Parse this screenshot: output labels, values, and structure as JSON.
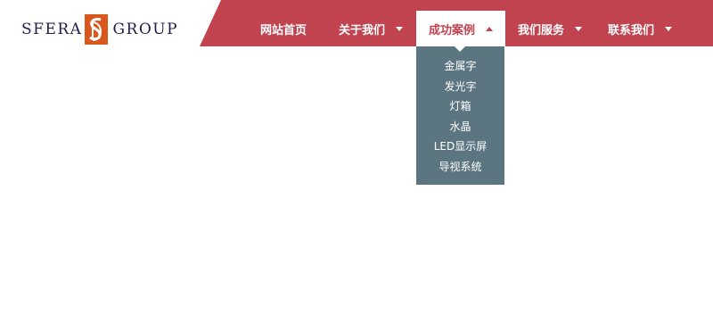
{
  "logo": {
    "left_text": "SFERA",
    "right_text": "GROUP",
    "mark_icon": "sd-monogram-icon",
    "text_color": "#1f1d4a",
    "mark_color": "#d9571c"
  },
  "nav": {
    "background_color": "#c0434f",
    "items": [
      {
        "label": "网站首页",
        "has_dropdown": false,
        "active": false
      },
      {
        "label": "关于我们",
        "has_dropdown": true,
        "active": false
      },
      {
        "label": "成功案例",
        "has_dropdown": true,
        "active": true
      },
      {
        "label": "我们服务",
        "has_dropdown": true,
        "active": false
      },
      {
        "label": "联系我们",
        "has_dropdown": true,
        "active": false
      }
    ]
  },
  "dropdown": {
    "background_color": "#5b7581",
    "items": [
      {
        "label": "金属字"
      },
      {
        "label": "发光字"
      },
      {
        "label": "灯箱"
      },
      {
        "label": "水晶"
      },
      {
        "label": "LED显示屏"
      },
      {
        "label": "导视系统"
      }
    ]
  }
}
